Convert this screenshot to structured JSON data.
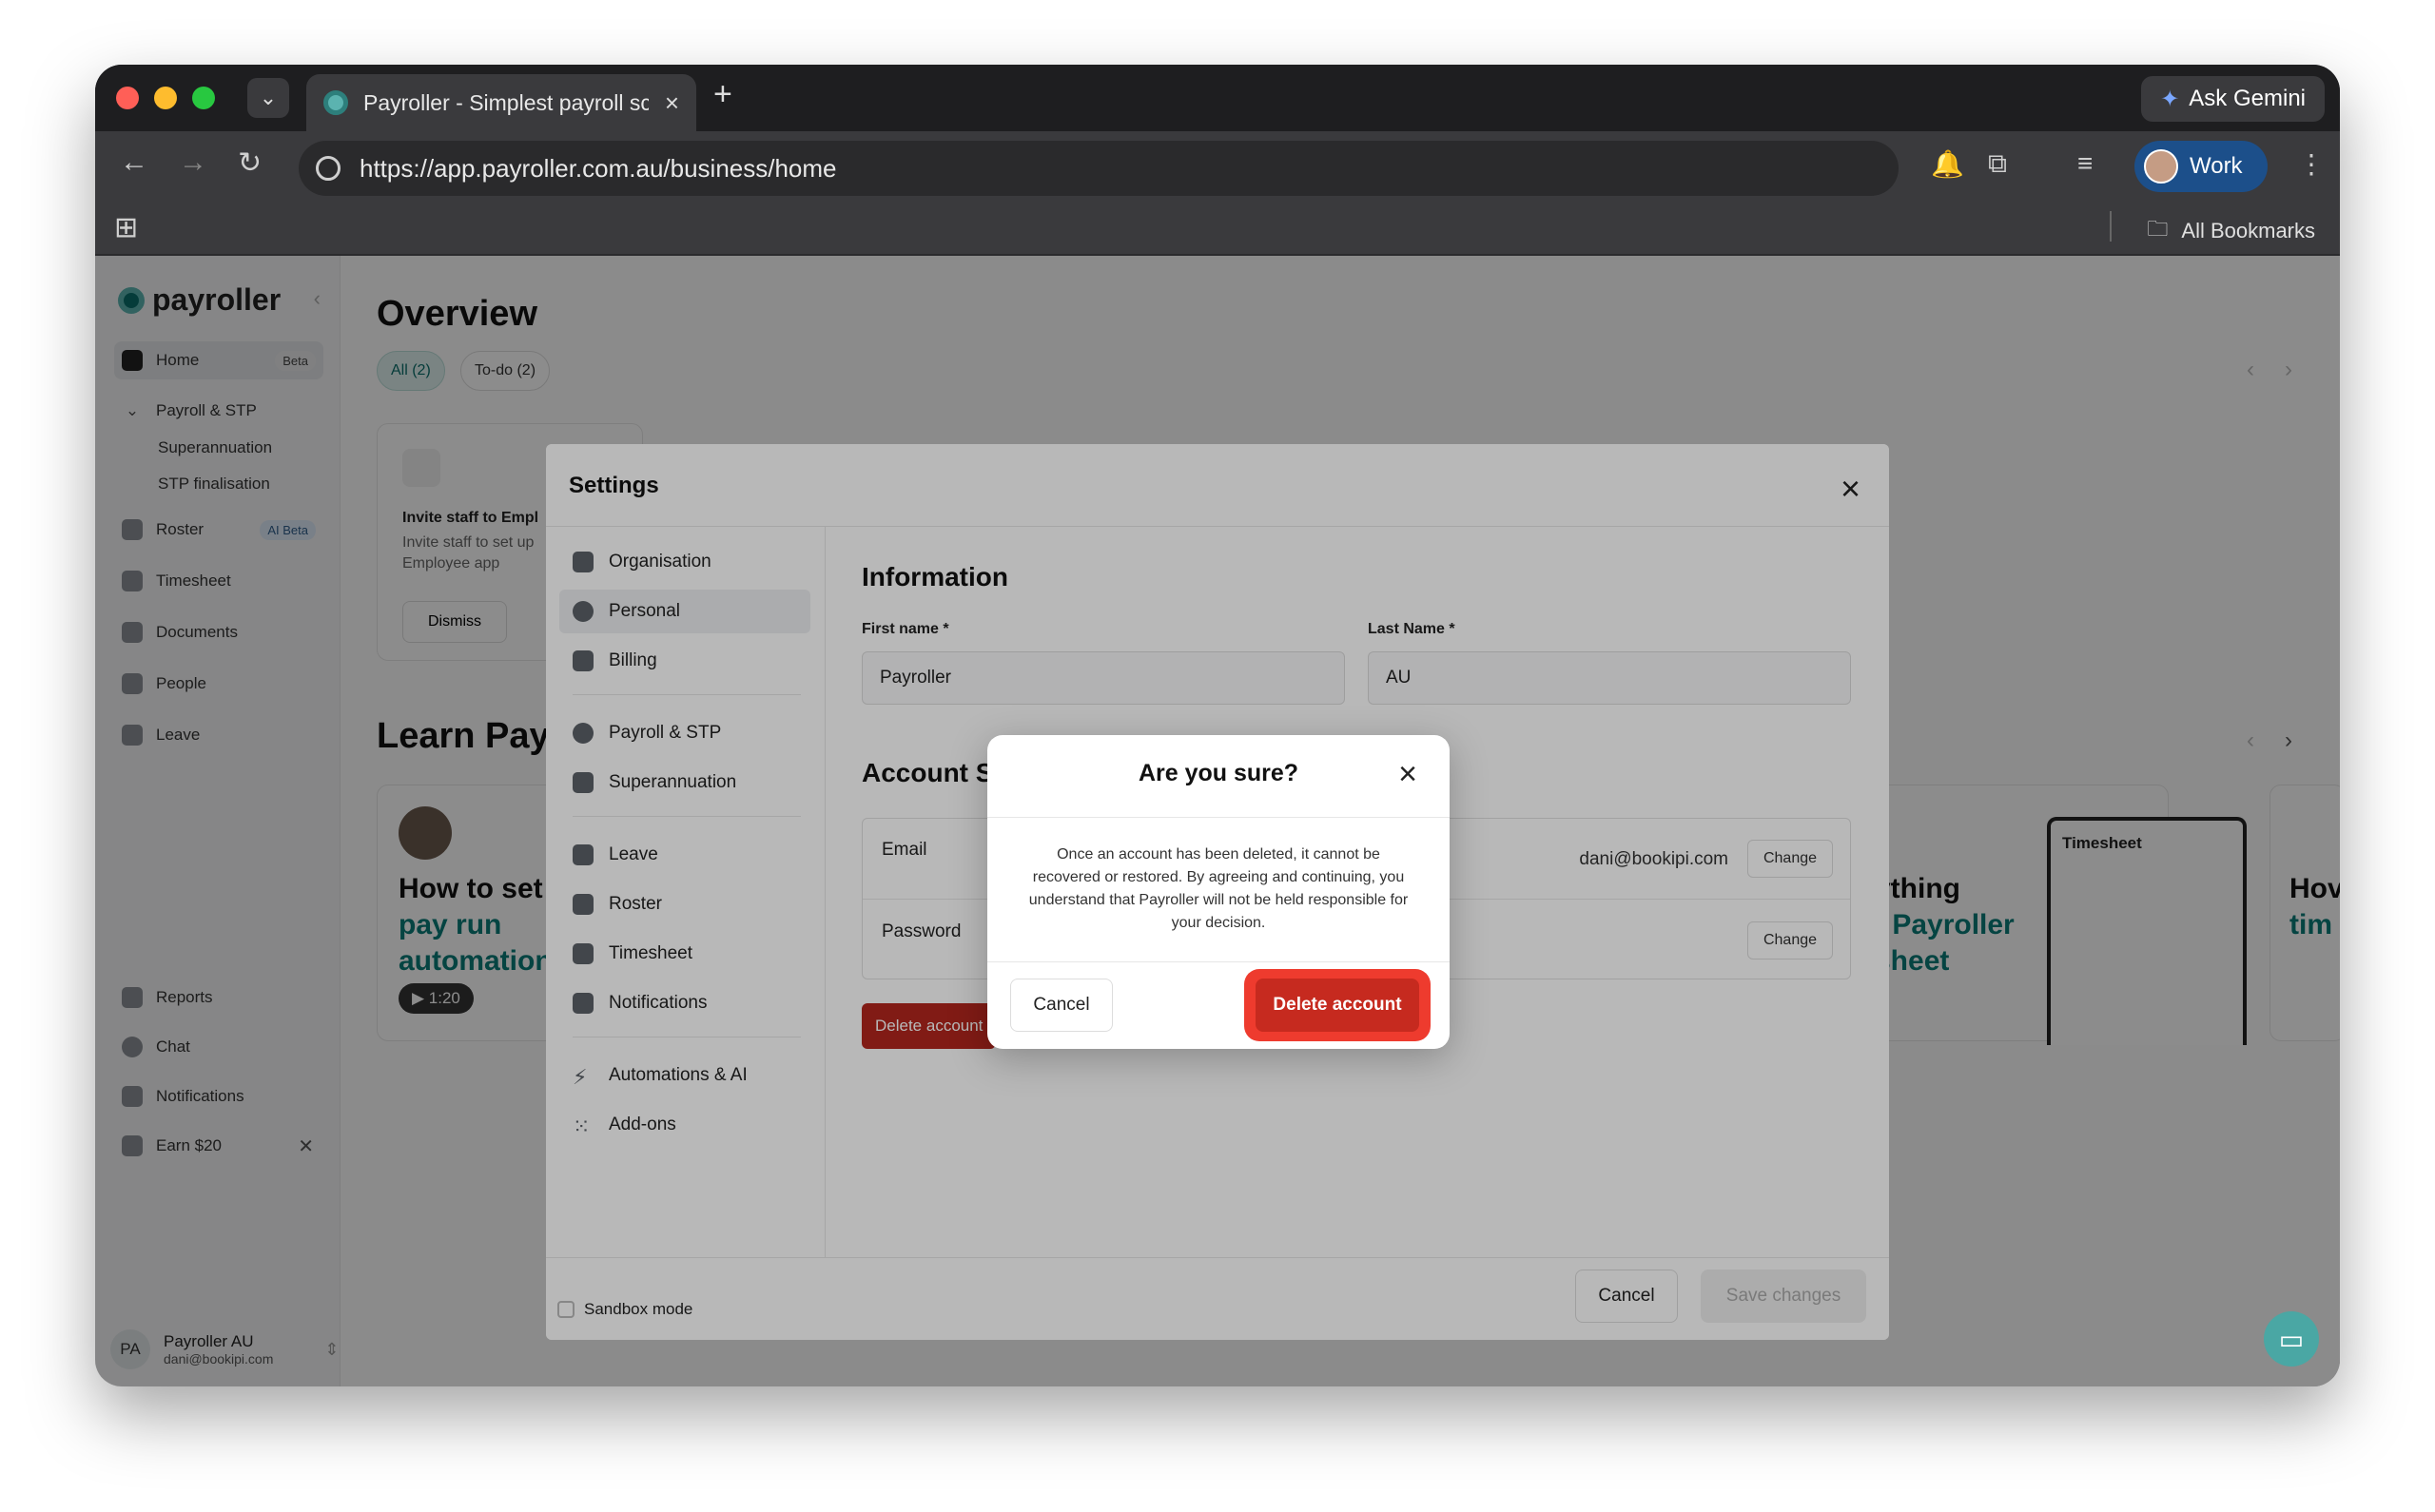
{
  "browser": {
    "tab_title": "Payroller - Simplest payroll sc",
    "tab_close": "×",
    "new_tab": "+",
    "ask_gemini": "Ask Gemini",
    "url": "https://app.payroller.com.au/business/home",
    "profile": "Work",
    "all_bookmarks": "All Bookmarks"
  },
  "sidebar": {
    "logo": "payroller",
    "items": [
      {
        "label": "Home",
        "badge": "Beta"
      },
      {
        "label": "Payroll & STP"
      },
      {
        "label": "Superannuation"
      },
      {
        "label": "STP finalisation"
      },
      {
        "label": "Roster",
        "badge": "AI Beta"
      },
      {
        "label": "Timesheet"
      },
      {
        "label": "Documents"
      },
      {
        "label": "People"
      },
      {
        "label": "Leave"
      },
      {
        "label": "Reports"
      },
      {
        "label": "Chat"
      },
      {
        "label": "Notifications"
      },
      {
        "label": "Earn $20"
      }
    ],
    "user": {
      "initials": "PA",
      "name": "Payroller AU",
      "email": "dani@bookipi.com"
    }
  },
  "main": {
    "title": "Overview",
    "chips": [
      "All (2)",
      "To-do (2)"
    ],
    "card_title": "Invite staff to Empl",
    "card_desc_1": "Invite staff to set up",
    "card_desc_2": "Employee app",
    "card_dismiss": "Dismiss",
    "learn_title": "Learn Payr",
    "video1_line1": "How to set u",
    "video1_line2": "pay run",
    "video1_line3": "automation",
    "video1_duration": "1:20",
    "video2_line1": "ything",
    "video2_line2a": "t ",
    "video2_line2b": "Payroller",
    "video2_line3": "sheet",
    "timesheet_label": "Timesheet",
    "video3_line1": "Hov",
    "video3_line2": "tim"
  },
  "settings": {
    "title": "Settings",
    "nav": [
      "Organisation",
      "Personal",
      "Billing",
      "Payroll & STP",
      "Superannuation",
      "Leave",
      "Roster",
      "Timesheet",
      "Notifications",
      "Automations & AI",
      "Add-ons"
    ],
    "information_title": "Information",
    "first_name_label": "First name *",
    "first_name_value": "Payroller",
    "last_name_label": "Last Name *",
    "last_name_value": "AU",
    "account_title": "Account S",
    "email_label": "Email",
    "email_value": "dani@bookipi.com",
    "password_label": "Password",
    "change_label": "Change",
    "delete_account": "Delete account",
    "sandbox_mode": "Sandbox mode",
    "cancel": "Cancel",
    "save_changes": "Save changes"
  },
  "confirm": {
    "title": "Are you sure?",
    "body": "Once an account has been deleted, it cannot be recovered or restored. By agreeing and continuing, you understand that Payroller will not be held responsible for your decision.",
    "cancel": "Cancel",
    "delete": "Delete account"
  },
  "colors": {
    "brand_teal": "#0a6e6a",
    "danger": "#c62a1f",
    "danger_highlight": "#ee3b2e"
  }
}
